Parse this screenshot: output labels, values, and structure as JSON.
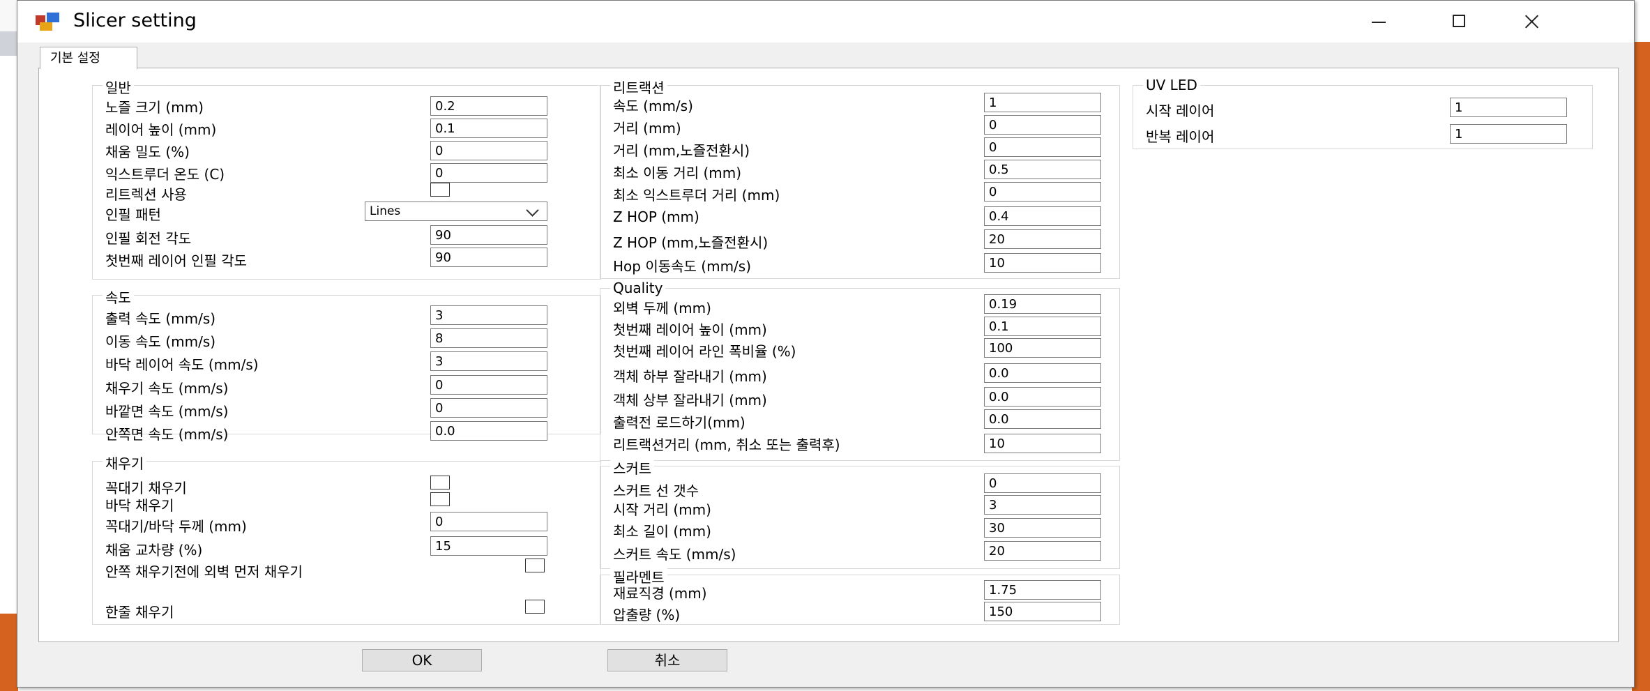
{
  "window": {
    "title": "Slicer setting"
  },
  "tabs": [
    "기본 설정"
  ],
  "general": {
    "title": "일반",
    "nozzle_label": "노즐 크기 (mm)",
    "nozzle": "0.2",
    "layer_label": "레이어 높이 (mm)",
    "layer": "0.1",
    "density_label": "채움 밀도 (%)",
    "density": "0",
    "temp_label": "익스트루더 온도 (C)",
    "temp": "0",
    "retract_use_label": "리트렉션 사용",
    "retract_use": false,
    "pattern_label": "인필 패턴",
    "pattern": "Lines",
    "rotation_label": "인필 회전 각도",
    "rotation": "90",
    "first_angle_label": "첫번째 레이어 인필 각도",
    "first_angle": "90"
  },
  "speed": {
    "title": "속도",
    "print_label": "출력 속도 (mm/s)",
    "print": "3",
    "travel_label": "이동 속도 (mm/s)",
    "travel": "8",
    "bottom_label": "바닥 레이어 속도 (mm/s)",
    "bottom": "3",
    "infill_label": "채우기 속도 (mm/s)",
    "infill": "0",
    "outer_label": "바깥면 속도 (mm/s)",
    "outer": "0",
    "inner_label": "안쪽면 속도 (mm/s)",
    "inner": "0.0"
  },
  "fill": {
    "title": "채우기",
    "top_label": "꼭대기 채우기",
    "top": false,
    "bottom_label": "바닥 채우기",
    "bottom": false,
    "thickness_label": "꼭대기/바닥 두께 (mm)",
    "thickness": "0",
    "overlap_label": "채움 교차량 (%)",
    "overlap": "15",
    "perim_first_label": "안쪽 채우기전에 외벽 먼저 채우기",
    "perim_first": false,
    "single_label": "한줄 채우기",
    "single": false
  },
  "retraction": {
    "title": "리트랙션",
    "speed_label": "속도 (mm/s)",
    "speed": "1",
    "distance_label": "거리 (mm)",
    "distance": "0",
    "distance_switch_label": "거리 (mm,노즐전환시)",
    "distance_switch": "0",
    "min_travel_label": "최소 이동 거리 (mm)",
    "min_travel": "0.5",
    "min_extrude_label": "최소 익스트루더 거리 (mm)",
    "min_extrude": "0",
    "zhop_label": "Z HOP (mm)",
    "zhop": "0.4",
    "zhop_switch_label": "Z HOP (mm,노즐전환시)",
    "zhop_switch": "20",
    "hop_speed_label": "Hop 이동속도 (mm/s)",
    "hop_speed": "10"
  },
  "quality": {
    "title": "Quality",
    "wall_label": "외벽 두께 (mm)",
    "wall": "0.19",
    "first_height_label": "첫번째 레이어 높이 (mm)",
    "first_height": "0.1",
    "first_width_label": "첫번째 레이어 라인 폭비율 (%)",
    "first_width": "100",
    "cut_bottom_label": "객체 하부 잘라내기 (mm)",
    "cut_bottom": "0.0",
    "cut_top_label": "객체 상부 잘라내기 (mm)",
    "cut_top": "0.0",
    "preload_label": "출력전 로드하기(mm)",
    "preload": "0.0",
    "retract_dist_label": "리트랙션거리 (mm, 취소 또는 출력후)",
    "retract_dist": "10"
  },
  "skirt": {
    "title": "스커트",
    "lines_label": "스커트 선 갯수",
    "lines": "0",
    "start_label": "시작 거리 (mm)",
    "start": "3",
    "minlen_label": "최소 길이 (mm)",
    "minlen": "30",
    "speed_label": "스커트 속도 (mm/s)",
    "speed": "20"
  },
  "filament": {
    "title": "필라멘트",
    "diameter_label": "재료직경 (mm)",
    "diameter": "1.75",
    "flow_label": "압출량 (%)",
    "flow": "150"
  },
  "uvled": {
    "title": "UV LED",
    "start_label": "시작 레이어",
    "start": "1",
    "repeat_label": "반복 레이어",
    "repeat": "1"
  },
  "buttons": {
    "ok": "OK",
    "cancel": "취소"
  }
}
